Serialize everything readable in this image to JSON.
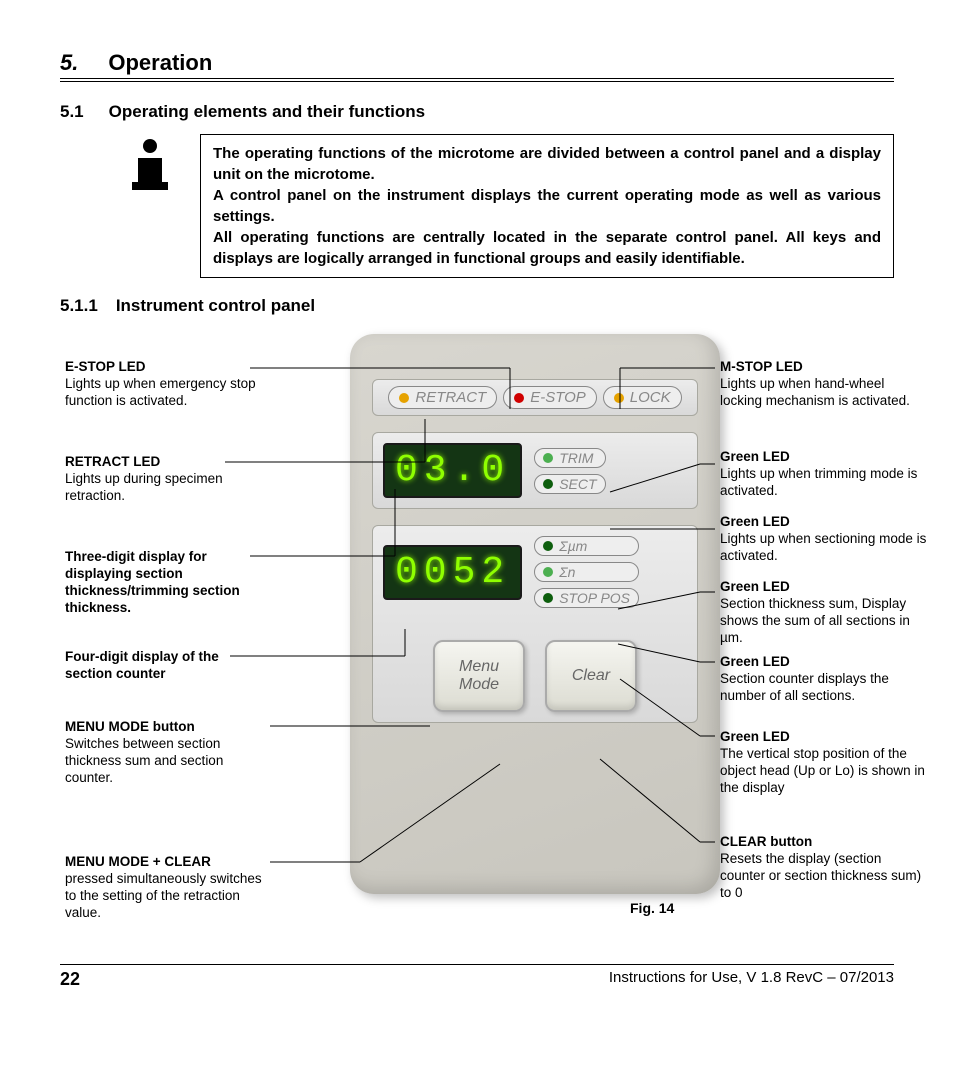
{
  "chapter": {
    "num": "5.",
    "title": "Operation"
  },
  "section": {
    "num": "5.1",
    "title": "Operating elements and their functions"
  },
  "info": {
    "p1": "The operating functions of the microtome are divided between a control panel and a display unit on the microtome.",
    "p2": "A control panel on the instrument displays the current operating mode as well as various settings.",
    "p3": "All operating functions are centrally located in the separate control panel. All keys and displays are logically arranged in functional groups and easily identifiable."
  },
  "subsection": {
    "num": "5.1.1",
    "title": "Instrument control panel"
  },
  "panel": {
    "row1": [
      "RETRACT",
      "E-STOP",
      "LOCK"
    ],
    "seg3": "03.0",
    "seg4": "0052",
    "trim": "TRIM",
    "sect": "SECT",
    "sum_um": "Σµm",
    "sum_n": "Σn",
    "stoppos": "STOP POS",
    "menu": "Menu\nMode",
    "clear": "Clear"
  },
  "left": {
    "a1t": "E-STOP LED",
    "a1": "Lights up when emergency stop function is activated.",
    "a2t": "RETRACT LED",
    "a2": "Lights up during specimen retraction.",
    "a3": "Three-digit display for displaying section thickness/trimming section thickness.",
    "a4": "Four-digit display of the section counter",
    "a5t": "MENU MODE button",
    "a5": "Switches between section thickness sum and section counter.",
    "a6t": "MENU MODE + CLEAR",
    "a6": "pressed simultaneously switches to the setting of the retraction value."
  },
  "right": {
    "b1t": "M-STOP LED",
    "b1": "Lights up when hand-wheel locking mechanism is activated.",
    "b2t": "Green LED",
    "b2": "Lights up when trimming mode is activated.",
    "b3t": "Green LED",
    "b3": "Lights up when sectioning mode is activated.",
    "b4t": "Green LED",
    "b4": "Section thickness sum, Display shows the sum of all sections in µm.",
    "b5t": "Green LED",
    "b5": "Section counter displays the number of all sections.",
    "b6t": "Green LED",
    "b6": "The vertical stop position of the object head (Up or Lo) is shown in the display",
    "b7t": "CLEAR button",
    "b7": "Resets the display (section counter or section thickness sum) to 0"
  },
  "fig": "Fig. 14",
  "footer": {
    "page": "22",
    "text": "Instructions for Use, V 1.8 RevC – 07/2013"
  }
}
